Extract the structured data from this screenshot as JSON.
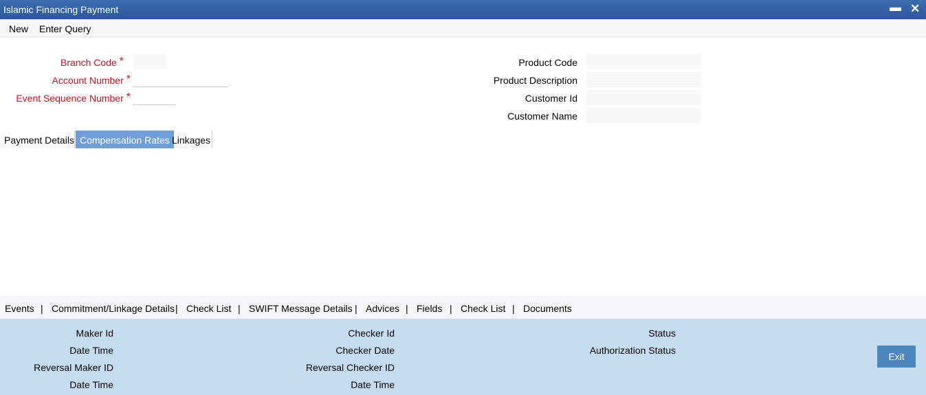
{
  "window": {
    "title": "Islamic Financing Payment",
    "minimize_glyph": "▬",
    "close_glyph": "✕"
  },
  "menu": {
    "new": "New",
    "enter_query": "Enter Query"
  },
  "form": {
    "branch_code_label": "Branch Code",
    "account_number_label": "Account Number",
    "event_seq_label": "Event Sequence Number",
    "required_marker": "*",
    "product_code_label": "Product Code",
    "product_desc_label": "Product Description",
    "customer_id_label": "Customer Id",
    "customer_name_label": "Customer Name",
    "branch_code_value": "",
    "account_number_value": "",
    "event_seq_value": "",
    "product_code_value": "",
    "product_desc_value": "",
    "customer_id_value": "",
    "customer_name_value": ""
  },
  "tabs": [
    {
      "label": "Payment Details",
      "active": false
    },
    {
      "label": "Compensation Rates",
      "active": true
    },
    {
      "label": "Linkages",
      "active": false
    }
  ],
  "links": [
    "Events",
    "Commitment/Linkage Details",
    "Check List",
    "SWIFT Message Details",
    "Advices",
    "Fields",
    "Check List",
    "Documents"
  ],
  "link_separator": "|",
  "footer": {
    "maker_id": "Maker Id",
    "date_time": "Date Time",
    "reversal_maker_id": "Reversal Maker ID",
    "checker_id": "Checker Id",
    "checker_date": "Checker Date",
    "reversal_checker_id": "Reversal Checker ID",
    "status": "Status",
    "authorization_status": "Authorization Status",
    "exit_label": "Exit"
  },
  "colors": {
    "title_bar": "#2c5899",
    "required_label": "#c41220",
    "active_tab": "#6f9fd8",
    "footer_bg": "#c6dcf0",
    "exit_button": "#4d86bd"
  }
}
